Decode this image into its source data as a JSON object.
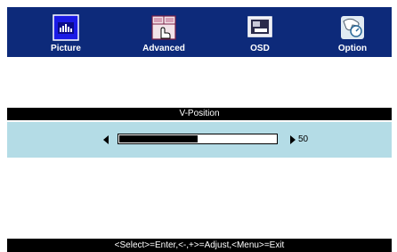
{
  "tabs": [
    {
      "label": "Picture",
      "icon": "picture-icon",
      "selected": true
    },
    {
      "label": "Advanced",
      "icon": "advanced-icon",
      "selected": false
    },
    {
      "label": "OSD",
      "icon": "osd-icon",
      "selected": false
    },
    {
      "label": "Option",
      "icon": "option-icon",
      "selected": false
    }
  ],
  "setting": {
    "title": "V-Position",
    "value": "50",
    "level_fraction": 0.5
  },
  "status": {
    "text": "<Select>=Enter,<-,+>=Adjust,<Menu>=Exit"
  },
  "colors": {
    "tabbar": "#0d2a7a",
    "selected_icon": "#1a1ae6",
    "row_highlight": "#b4dce6",
    "bars": "#000000"
  }
}
